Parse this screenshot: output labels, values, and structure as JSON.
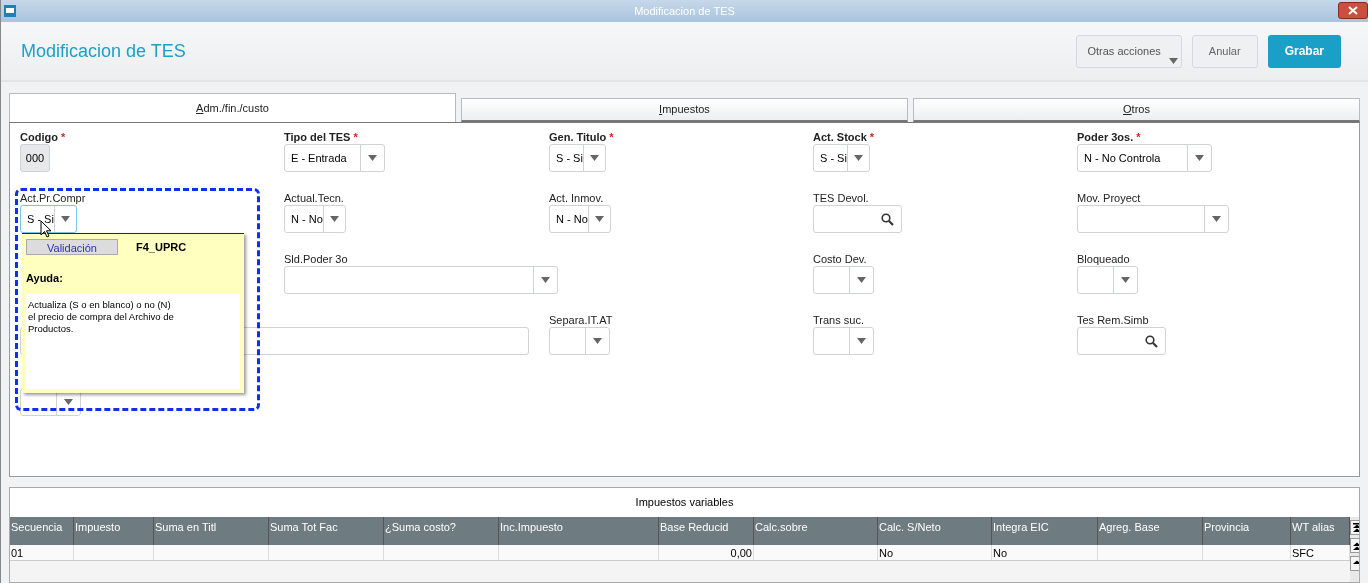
{
  "window": {
    "title": "Modificacion de TES"
  },
  "header": {
    "title": "Modificacion de TES",
    "buttons": [
      {
        "label": "Otras acciones",
        "kind": "menu"
      },
      {
        "label": "Anular",
        "kind": "plain"
      },
      {
        "label": "Grabar",
        "kind": "primary"
      }
    ]
  },
  "tabs": [
    {
      "label": "Adm./fin./custo",
      "selected": true
    },
    {
      "label": "Impuestos",
      "selected": false
    },
    {
      "label": "Otros",
      "selected": false
    }
  ],
  "form_rows": [
    [
      {
        "kind": "readonly",
        "label": "Codigo",
        "mark": "*",
        "value": "000"
      },
      {
        "kind": "select",
        "label": "Tipo del TES",
        "mark": "*",
        "value": "E - Entrada",
        "focused": false
      },
      {
        "kind": "select",
        "label": "Gen. Titulo",
        "mark": "*",
        "value": "S - Si",
        "focused": false
      },
      {
        "kind": "select",
        "label": "Act. Stock",
        "mark": "*",
        "value": "S - Si",
        "focused": false
      },
      {
        "kind": "select",
        "label": "Poder 3os.",
        "mark": "*",
        "value": "N - No Controla",
        "focused": false
      }
    ],
    [
      {
        "kind": "select",
        "label": "Act.Pr.Compr",
        "value": "S - Si",
        "focused": true
      },
      {
        "kind": "select",
        "label": "Actual.Tecn.",
        "value": "N - No",
        "focused": false
      },
      {
        "kind": "select",
        "label": "Act. Inmov.",
        "value": "N - No",
        "focused": false
      },
      {
        "kind": "search",
        "label": "TES Devol."
      },
      {
        "kind": "select",
        "label": "Mov. Proyect",
        "focused": false
      }
    ],
    [
      {
        "kind": "blank"
      },
      {
        "kind": "select",
        "label": "Sld.Poder 3o",
        "focused": false
      },
      {
        "kind": "blank"
      },
      {
        "kind": "select",
        "label": "Costo Dev.",
        "focused": false
      },
      {
        "kind": "select",
        "label": "Bloqueado",
        "focused": false
      }
    ],
    [
      {
        "kind": "text"
      },
      {
        "kind": "select",
        "label": "Separa.IT.AT",
        "focused": false
      },
      {
        "kind": "select",
        "label": "Trans suc.",
        "focused": false
      },
      {
        "kind": "search",
        "label": "Tes Rem.Simb"
      }
    ],
    [
      {
        "kind": "select",
        "focused": false
      }
    ]
  ],
  "help_popup": {
    "tab": "Validación",
    "code": "F4_UPRC",
    "heading": "Ayuda:",
    "text": "Actualiza (S o en blanco) o no (N)\nel precio de compra del Archivo de\nProductos."
  },
  "table": {
    "title": "Impuestos variables",
    "columns": [
      "Secuencia",
      "Impuesto",
      "Suma en Titl",
      "Suma Tot Fac",
      "¿Suma costo?",
      "Inc.Impuesto",
      "Base Reducid",
      "Calc.sobre",
      "Calc. S/Neto",
      "Integra EIC",
      "Agreg. Base",
      "Provincia",
      "WT alias"
    ],
    "rows": [
      [
        "01",
        "",
        "",
        "",
        "",
        "",
        "0,00",
        "",
        "No",
        "No",
        "",
        "",
        "SFC"
      ]
    ]
  }
}
